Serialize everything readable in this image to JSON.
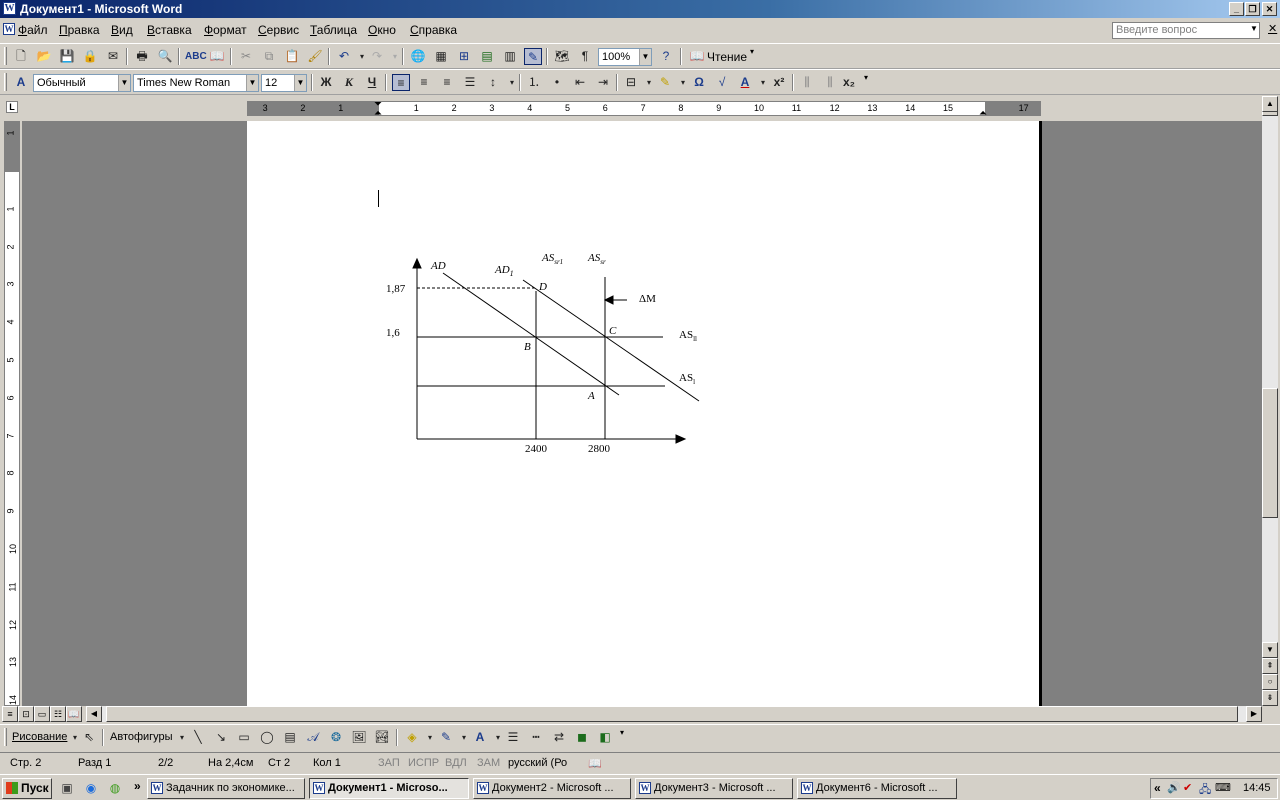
{
  "window": {
    "title": "Документ1 - Microsoft Word",
    "app_icon_letter": "W"
  },
  "caption_buttons": [
    "_",
    "❐",
    "✕"
  ],
  "menu": {
    "items": [
      "Файл",
      "Правка",
      "Вид",
      "Вставка",
      "Формат",
      "Сервис",
      "Таблица",
      "Окно",
      "Справка"
    ],
    "ask_placeholder": "Введите вопрос",
    "close_doc": "✕"
  },
  "standard_toolbar": {
    "zoom": "100%",
    "read_button": "Чтение"
  },
  "format_toolbar": {
    "style": "Обычный",
    "font": "Times New Roman",
    "size": "12",
    "bold": "Ж",
    "italic": "К",
    "underline": "Ч"
  },
  "ruler": {
    "h_ticks": [
      "3",
      "2",
      "1",
      "1",
      "2",
      "3",
      "4",
      "5",
      "6",
      "7",
      "8",
      "9",
      "10",
      "11",
      "12",
      "13",
      "14",
      "15",
      "17"
    ],
    "v_ticks": [
      "1",
      "1",
      "2",
      "3",
      "4",
      "5",
      "6",
      "7",
      "8",
      "9",
      "10",
      "11",
      "12",
      "13",
      "14"
    ]
  },
  "figure": {
    "labels": {
      "ad": "AD",
      "ad1": "AD",
      "ad1_sub": "1",
      "as_sr1": "AS",
      "as_sr1_sub": "sr1",
      "as_sr": "AS",
      "as_sr_sub": "sr",
      "y_187": "1,87",
      "y_16": "1,6",
      "d": "D",
      "c": "C",
      "b": "B",
      "a": "A",
      "delta_m": "ΔM",
      "as_ll": "AS",
      "as_ll_sub": "ll",
      "as_l": "AS",
      "as_l_sub": "l",
      "x_2400": "2400",
      "x_2800": "2800"
    }
  },
  "drawing_toolbar": {
    "draw": "Рисование",
    "autoshapes": "Автофигуры"
  },
  "status": {
    "page": "Стр. 2",
    "section": "Разд 1",
    "pages": "2/2",
    "at": "На 2,4см",
    "line": "Ст 2",
    "col": "Кол 1",
    "rec": "ЗАП",
    "trk": "ИСПР",
    "ext": "ВДЛ",
    "ovr": "ЗАМ",
    "lang": "русский (Ро"
  },
  "taskbar": {
    "start": "Пуск",
    "chevron": "»",
    "tasks": [
      {
        "label": "Задачник по экономике...",
        "active": false
      },
      {
        "label": "Документ1 - Microso...",
        "active": true
      },
      {
        "label": "Документ2 - Microsoft ...",
        "active": false
      },
      {
        "label": "Документ3 - Microsoft ...",
        "active": false
      },
      {
        "label": "Документ6 - Microsoft ...",
        "active": false
      }
    ],
    "tray_chevron": "«",
    "clock": "14:45"
  }
}
